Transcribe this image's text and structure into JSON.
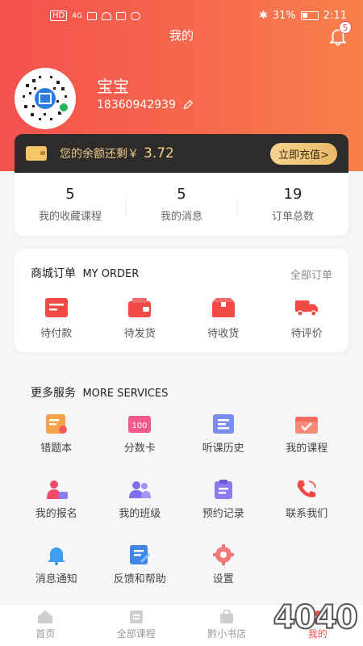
{
  "status_bar": {
    "left": [
      "HD",
      "4G"
    ],
    "battery": "31%",
    "time": "2:11"
  },
  "header": {
    "title": "我的",
    "notification_count": "5"
  },
  "profile": {
    "name": "宝宝",
    "phone": "18360942939"
  },
  "balance": {
    "label": "您的余额还剩￥",
    "amount": "3.72",
    "recharge": "立即充值>"
  },
  "stats": [
    {
      "value": "5",
      "label": "我的收藏课程"
    },
    {
      "value": "5",
      "label": "我的消息"
    },
    {
      "value": "19",
      "label": "订单总数"
    }
  ],
  "order": {
    "title": "商城订单",
    "title_en": "MY ORDER",
    "all_label": "全部订单",
    "items": [
      {
        "label": "待付款",
        "icon": "wallet-card-icon"
      },
      {
        "label": "待发货",
        "icon": "package-wallet-icon"
      },
      {
        "label": "待收货",
        "icon": "box-icon"
      },
      {
        "label": "待评价",
        "icon": "truck-icon"
      }
    ]
  },
  "services": {
    "title": "更多服务",
    "title_en": "MORE SERVICES",
    "items": [
      {
        "label": "错题本",
        "icon": "wrong-book-icon"
      },
      {
        "label": "分数卡",
        "icon": "score-card-icon"
      },
      {
        "label": "听课历史",
        "icon": "history-icon"
      },
      {
        "label": "我的课程",
        "icon": "calendar-check-icon"
      },
      {
        "label": "我的报名",
        "icon": "person-card-icon"
      },
      {
        "label": "我的班级",
        "icon": "group-icon"
      },
      {
        "label": "预约记录",
        "icon": "clipboard-icon"
      },
      {
        "label": "联系我们",
        "icon": "phone-icon"
      },
      {
        "label": "消息通知",
        "icon": "bell-icon"
      },
      {
        "label": "反馈和帮助",
        "icon": "edit-doc-icon"
      },
      {
        "label": "设置",
        "icon": "gear-icon"
      }
    ]
  },
  "bottom_nav": [
    {
      "label": "首页",
      "icon": "home-icon"
    },
    {
      "label": "全部课程",
      "icon": "courses-icon"
    },
    {
      "label": "黔小书店",
      "icon": "shop-bag-icon"
    },
    {
      "label": "我的",
      "icon": "user-icon"
    }
  ],
  "watermark": "4040"
}
